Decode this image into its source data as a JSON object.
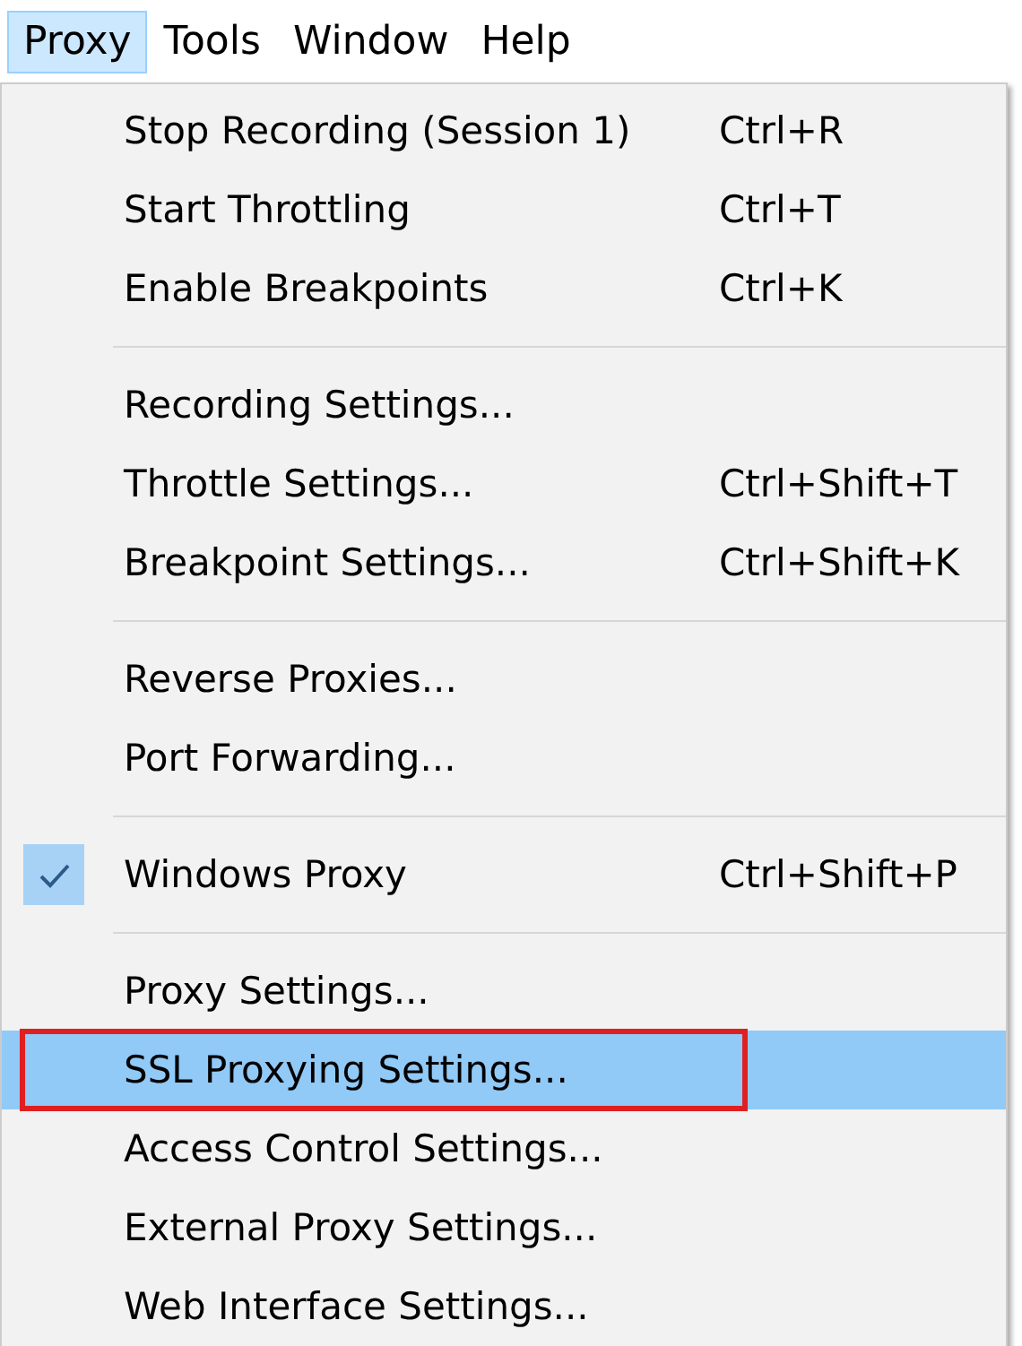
{
  "menu_bar": [
    {
      "label": "Proxy",
      "selected": true
    },
    {
      "label": "Tools",
      "selected": false
    },
    {
      "label": "Window",
      "selected": false
    },
    {
      "label": "Help",
      "selected": false
    }
  ],
  "menu": {
    "groups": [
      [
        {
          "label": "Stop Recording (Session 1)",
          "shortcut": "Ctrl+R",
          "checked": false,
          "selected": false,
          "annotated": false
        },
        {
          "label": "Start Throttling",
          "shortcut": "Ctrl+T",
          "checked": false,
          "selected": false,
          "annotated": false
        },
        {
          "label": "Enable Breakpoints",
          "shortcut": "Ctrl+K",
          "checked": false,
          "selected": false,
          "annotated": false
        }
      ],
      [
        {
          "label": "Recording Settings...",
          "checked": false,
          "selected": false,
          "annotated": false
        },
        {
          "label": "Throttle Settings...",
          "shortcut": "Ctrl+Shift+T",
          "checked": false,
          "selected": false,
          "annotated": false
        },
        {
          "label": "Breakpoint Settings...",
          "shortcut": "Ctrl+Shift+K",
          "checked": false,
          "selected": false,
          "annotated": false
        }
      ],
      [
        {
          "label": "Reverse Proxies...",
          "checked": false,
          "selected": false,
          "annotated": false
        },
        {
          "label": "Port Forwarding...",
          "checked": false,
          "selected": false,
          "annotated": false
        }
      ],
      [
        {
          "label": "Windows Proxy",
          "shortcut": "Ctrl+Shift+P",
          "checked": true,
          "selected": false,
          "annotated": false
        }
      ],
      [
        {
          "label": "Proxy Settings...",
          "checked": false,
          "selected": false,
          "annotated": false
        },
        {
          "label": "SSL Proxying Settings...",
          "checked": false,
          "selected": true,
          "annotated": true
        },
        {
          "label": "Access Control Settings...",
          "checked": false,
          "selected": false,
          "annotated": false
        },
        {
          "label": "External Proxy Settings...",
          "checked": false,
          "selected": false,
          "annotated": false
        },
        {
          "label": "Web Interface Settings...",
          "checked": false,
          "selected": false,
          "annotated": false
        }
      ]
    ]
  }
}
